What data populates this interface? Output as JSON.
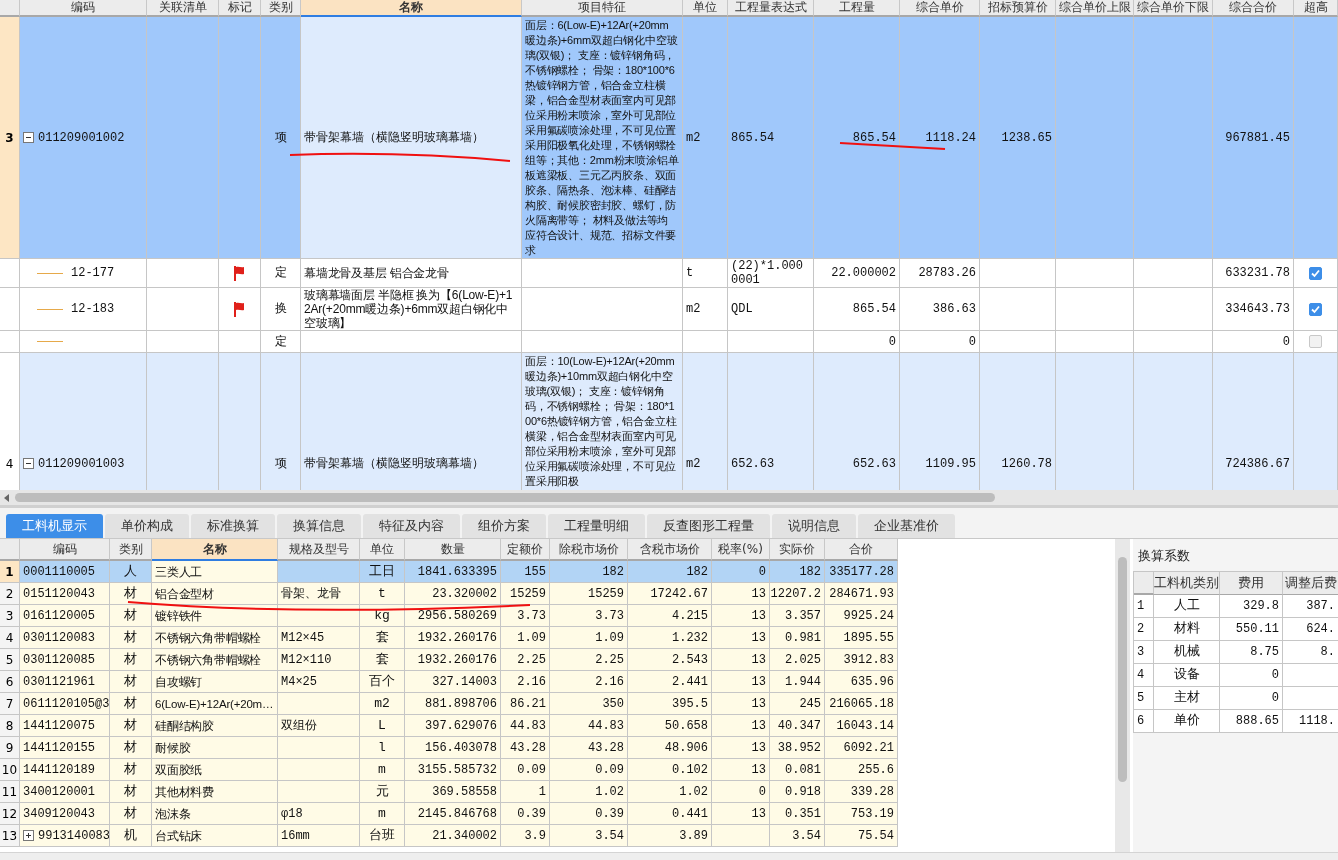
{
  "bill_grid": {
    "columns": [
      "编码",
      "关联清单",
      "标记",
      "类别",
      "名称",
      "项目特征",
      "单位",
      "工程量表达式",
      "工程量",
      "综合单价",
      "招标预算价",
      "综合单价上限",
      "综合单价下限",
      "综合合价",
      "超高"
    ],
    "rows": [
      {
        "row_no": "3",
        "selected": true,
        "expanded": true,
        "code": "011209001002",
        "type": "项",
        "name": "带骨架幕墙（横隐竖明玻璃幕墙）",
        "features": "面层：6(Low-E)+12Ar(+20mm暖边条)+6mm双超白钢化中空玻璃(双银)； 支座：镀锌钢角码，不锈钢螺栓； 骨架：180*100*6热镀锌钢方管，铝合金立柱横梁，铝合金型材表面室内可见部位采用粉末喷涂，室外可见部位采用氟碳喷涂处理，不可见位置采用阳极氧化处理，不锈钢螺栓组等；其他：2mm粉末喷涂铝单板遮梁板、三元乙丙胶条、双面胶条、隔热条、泡沫棒、硅酮结构胶、耐候胶密封胶、螺钉，防火隔离带等； 材料及做法等均应符合设计、规范、招标文件要求",
        "unit": "m2",
        "qty_expr": "865.54",
        "qty": "865.54",
        "unit_price": "1118.24",
        "bid_price": "1238.65",
        "total": "967881.45",
        "children": [
          {
            "code": "12-177",
            "flagged": true,
            "type": "定",
            "name": "幕墙龙骨及基层 铝合金龙骨",
            "unit": "t",
            "qty_expr": "(22)*1.0000001",
            "qty": "22.000002",
            "unit_price": "28783.26",
            "total": "633231.78",
            "over_height": true
          },
          {
            "code": "12-183",
            "flagged": true,
            "type": "换",
            "name": "玻璃幕墙面层 半隐框  换为【6(Low-E)+12Ar(+20mm暖边条)+6mm双超白钢化中空玻璃】",
            "unit": "m2",
            "qty_expr": "QDL",
            "qty": "865.54",
            "unit_price": "386.63",
            "total": "334643.73",
            "over_height": true
          },
          {
            "flagged": false,
            "type": "定",
            "qty": "0",
            "unit_price": "0",
            "total": "0",
            "over_height": false
          }
        ]
      },
      {
        "row_no": "4",
        "selected": false,
        "expanded": true,
        "code": "011209001003",
        "type": "项",
        "name": "带骨架幕墙（横隐竖明玻璃幕墙）",
        "features": "面层：10(Low-E)+12Ar(+20mm暖边条)+10mm双超白钢化中空玻璃(双银)； 支座：镀锌钢角码，不锈钢螺栓； 骨架：180*100*6热镀锌钢方管，铝合金立柱横梁，铝合金型材表面室内可见部位采用粉末喷涂，室外可见部位采用氟碳喷涂处理，不可见位置采用阳极",
        "unit": "m2",
        "qty_expr": "652.63",
        "qty": "652.63",
        "unit_price": "1109.95",
        "bid_price": "1260.78",
        "total": "724386.67",
        "children": []
      }
    ]
  },
  "tabs": [
    {
      "label": "工料机显示",
      "selected": true
    },
    {
      "label": "单价构成",
      "selected": false
    },
    {
      "label": "标准换算",
      "selected": false
    },
    {
      "label": "换算信息",
      "selected": false
    },
    {
      "label": "特征及内容",
      "selected": false
    },
    {
      "label": "组价方案",
      "selected": false
    },
    {
      "label": "工程量明细",
      "selected": false
    },
    {
      "label": "反查图形工程量",
      "selected": false
    },
    {
      "label": "说明信息",
      "selected": false
    },
    {
      "label": "企业基准价",
      "selected": false
    }
  ],
  "resource_grid": {
    "columns": [
      "编码",
      "类别",
      "名称",
      "规格及型号",
      "单位",
      "数量",
      "定额价",
      "除税市场价",
      "含税市场价",
      "税率(%)",
      "实际价",
      "合价"
    ],
    "rows": [
      {
        "row_no": "1",
        "selected": true,
        "cells": [
          "0001110005",
          "人",
          "三类人工",
          "",
          "工日",
          "1841.633395",
          "155",
          "182",
          "182",
          "0",
          "182",
          "335177.28"
        ]
      },
      {
        "row_no": "2",
        "selected": false,
        "cells": [
          "0151120043",
          "材",
          "铝合金型材",
          "骨架、龙骨",
          "t",
          "23.320002",
          "15259",
          "15259",
          "17242.67",
          "13",
          "12207.2",
          "284671.93"
        ]
      },
      {
        "row_no": "3",
        "selected": false,
        "cells": [
          "0161120005",
          "材",
          "镀锌铁件",
          "",
          "kg",
          "2956.580269",
          "3.73",
          "3.73",
          "4.215",
          "13",
          "3.357",
          "9925.24"
        ]
      },
      {
        "row_no": "4",
        "selected": false,
        "cells": [
          "0301120083",
          "材",
          "不锈钢六角带帽螺栓",
          "M12×45",
          "套",
          "1932.260176",
          "1.09",
          "1.09",
          "1.232",
          "13",
          "0.981",
          "1895.55"
        ]
      },
      {
        "row_no": "5",
        "selected": false,
        "cells": [
          "0301120085",
          "材",
          "不锈钢六角带帽螺栓",
          "M12×110",
          "套",
          "1932.260176",
          "2.25",
          "2.25",
          "2.543",
          "13",
          "2.025",
          "3912.83"
        ]
      },
      {
        "row_no": "6",
        "selected": false,
        "cells": [
          "0301121961",
          "材",
          "自攻螺钉",
          "M4×25",
          "百个",
          "327.14003",
          "2.16",
          "2.16",
          "2.441",
          "13",
          "1.944",
          "635.96"
        ]
      },
      {
        "row_no": "7",
        "selected": false,
        "cells": [
          "0611120105@3",
          "材",
          "6(Low-E)+12Ar(+20m…",
          "",
          "m2",
          "881.898706",
          "86.21",
          "350",
          "395.5",
          "13",
          "245",
          "216065.18"
        ]
      },
      {
        "row_no": "8",
        "selected": false,
        "cells": [
          "1441120075",
          "材",
          "硅酮结构胶",
          "双组份",
          "L",
          "397.629076",
          "44.83",
          "44.83",
          "50.658",
          "13",
          "40.347",
          "16043.14"
        ]
      },
      {
        "row_no": "9",
        "selected": false,
        "cells": [
          "1441120155",
          "材",
          "耐候胶",
          "",
          "l",
          "156.403078",
          "43.28",
          "43.28",
          "48.906",
          "13",
          "38.952",
          "6092.21"
        ]
      },
      {
        "row_no": "10",
        "selected": false,
        "cells": [
          "1441120189",
          "材",
          "双面胶纸",
          "",
          "m",
          "3155.585732",
          "0.09",
          "0.09",
          "0.102",
          "13",
          "0.081",
          "255.6"
        ]
      },
      {
        "row_no": "11",
        "selected": false,
        "cells": [
          "3400120001",
          "材",
          "其他材料费",
          "",
          "元",
          "369.58558",
          "1",
          "1.02",
          "1.02",
          "0",
          "0.918",
          "339.28"
        ]
      },
      {
        "row_no": "12",
        "selected": false,
        "cells": [
          "3409120043",
          "材",
          "泡沫条",
          "φ18",
          "m",
          "2145.846768",
          "0.39",
          "0.39",
          "0.441",
          "13",
          "0.351",
          "753.19"
        ]
      },
      {
        "row_no": "13",
        "selected": false,
        "expanded": false,
        "cells": [
          "9913140083",
          "机",
          "台式钻床",
          "16mm",
          "台班",
          "21.340002",
          "3.9",
          "3.54",
          "3.89",
          "",
          "3.54",
          "75.54"
        ]
      }
    ]
  },
  "conversion_panel": {
    "title": "换算系数",
    "columns": [
      "工料机类别",
      "费用",
      "调整后费"
    ],
    "rows": [
      {
        "no": "1",
        "category": "人工",
        "cost": "329.8",
        "adjusted": "387."
      },
      {
        "no": "2",
        "category": "材料",
        "cost": "550.11",
        "adjusted": "624."
      },
      {
        "no": "3",
        "category": "机械",
        "cost": "8.75",
        "adjusted": "8."
      },
      {
        "no": "4",
        "category": "设备",
        "cost": "0"
      },
      {
        "no": "5",
        "category": "主材",
        "cost": "0"
      },
      {
        "no": "6",
        "category": "单价",
        "cost": "888.65",
        "adjusted": "1118."
      }
    ]
  }
}
